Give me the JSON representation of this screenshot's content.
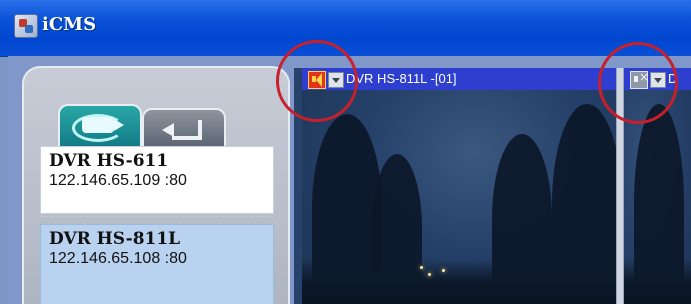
{
  "window": {
    "title": "iCMS",
    "app_icon": "app-logo-icon"
  },
  "left_panel": {
    "tabs": [
      {
        "name": "camera-view",
        "icon": "camera-icon",
        "active": true
      },
      {
        "name": "playback",
        "icon": "playback-icon",
        "active": false
      }
    ],
    "devices": [
      {
        "name": "DVR HS-611",
        "address": "122.146.65.109 :80",
        "selected": false
      },
      {
        "name": "DVR HS-811L",
        "address": "122.146.65.108 :80",
        "selected": true
      }
    ]
  },
  "video": {
    "channels": [
      {
        "title": "DVR HS-811L -[01]",
        "audio": "on",
        "audio_icon": "speaker-on-icon",
        "menu_icon": "dropdown-icon"
      },
      {
        "title": "D",
        "audio": "muted",
        "audio_icon": "speaker-muted-icon",
        "menu_icon": "dropdown-icon"
      }
    ]
  },
  "colors": {
    "titlebar": "#0046cf",
    "channel_bar": "#2e3fd0",
    "selected_row": "#b9d2ef",
    "annotation_circle": "#c8202a"
  }
}
